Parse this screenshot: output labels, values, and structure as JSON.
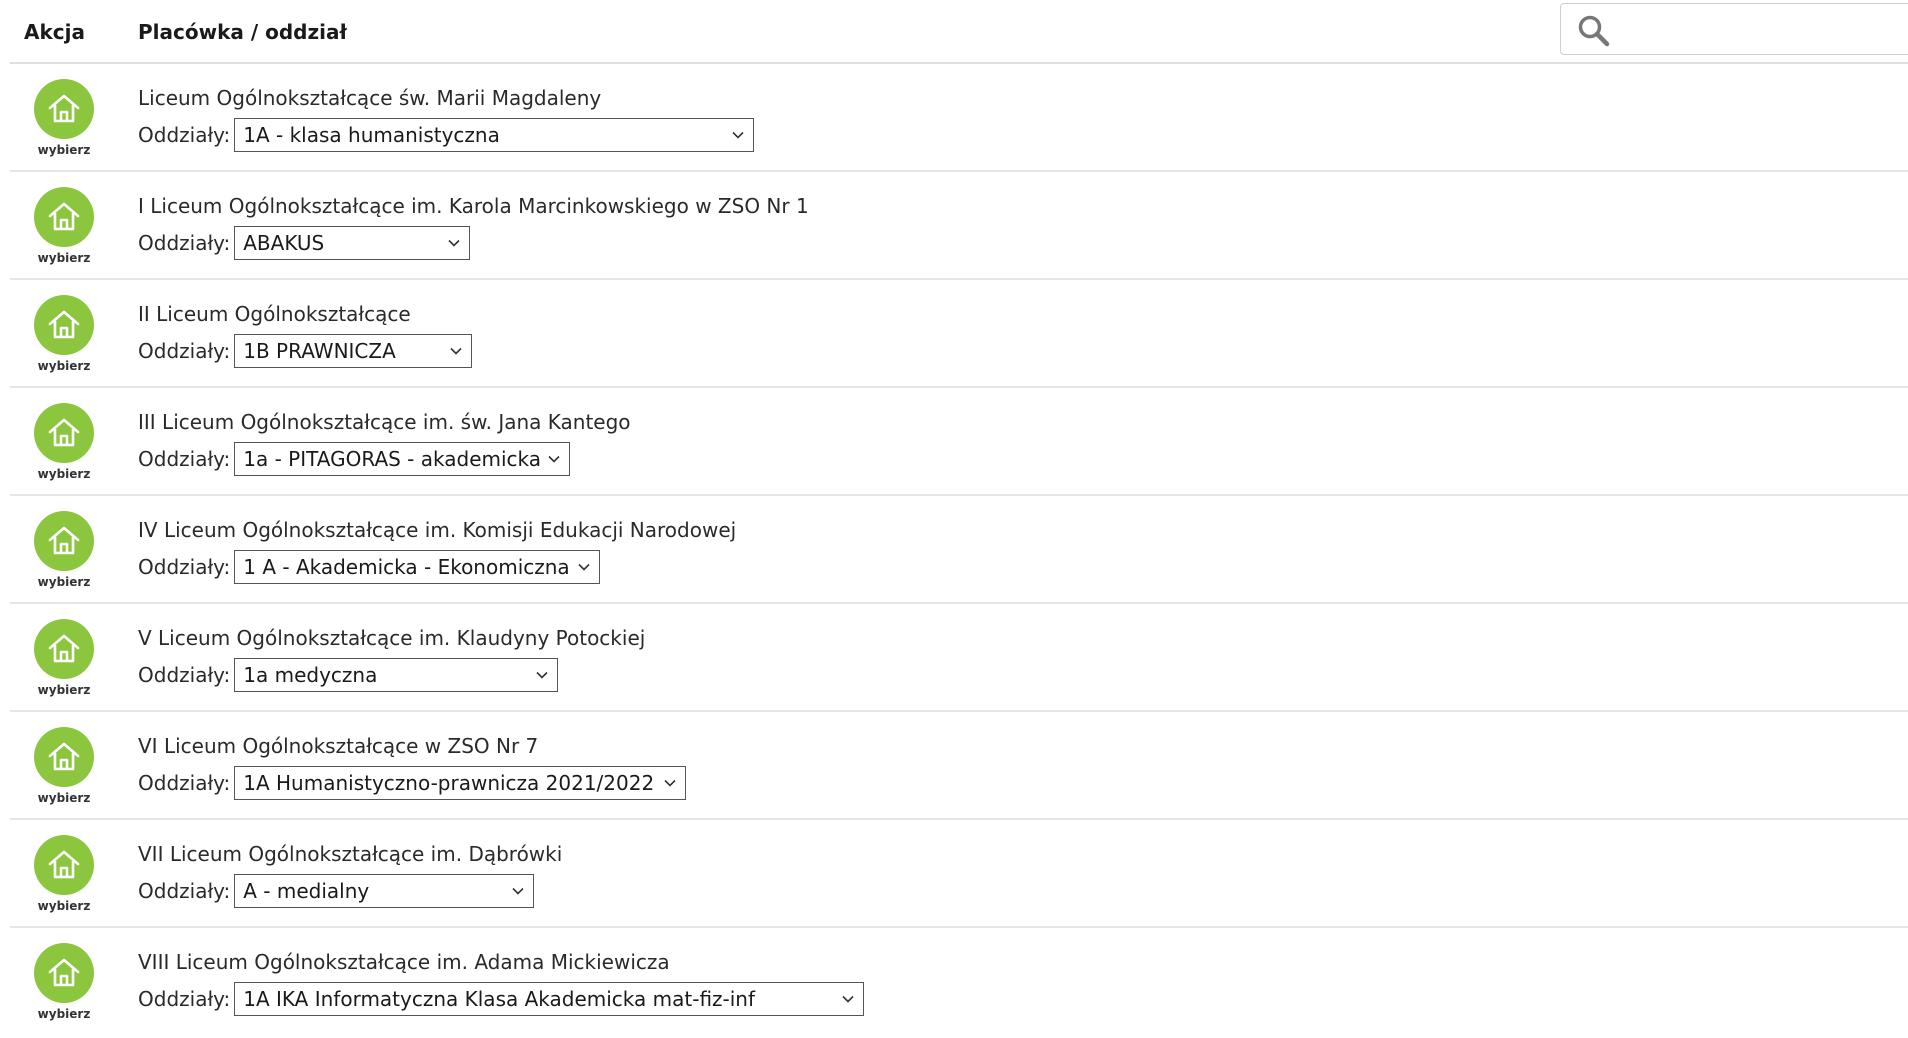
{
  "header": {
    "action_label": "Akcja",
    "school_label": "Placówka / oddział",
    "search_placeholder": "",
    "search_value": ""
  },
  "colors": {
    "accent": "#8cc63f",
    "divider": "#e6e6e6"
  },
  "dept_prefix": "Oddziały:",
  "action_button_label": "wybierz",
  "icons": {
    "action": "home-icon",
    "search": "search-icon",
    "dropdown": "chevron-down-icon"
  },
  "schools": [
    {
      "name": "Liceum Ogólnokształcące św. Marii Magdaleny",
      "selected_department": "1A - klasa humanistyczna"
    },
    {
      "name": "I Liceum Ogólnokształcące im. Karola Marcinkowskiego w ZSO Nr 1",
      "selected_department": "ABAKUS"
    },
    {
      "name": "II Liceum Ogólnokształcące",
      "selected_department": "1B PRAWNICZA"
    },
    {
      "name": "III Liceum Ogólnokształcące im. św. Jana Kantego",
      "selected_department": "1a - PITAGORAS - akademicka"
    },
    {
      "name": "IV Liceum Ogólnokształcące im. Komisji Edukacji Narodowej",
      "selected_department": "1 A - Akademicka - Ekonomiczna"
    },
    {
      "name": "V Liceum Ogólnokształcące im. Klaudyny Potockiej",
      "selected_department": "1a medyczna"
    },
    {
      "name": "VI Liceum Ogólnokształcące w ZSO Nr 7",
      "selected_department": "1A Humanistyczno-prawnicza 2021/2022"
    },
    {
      "name": "VII Liceum Ogólnokształcące im. Dąbrówki",
      "selected_department": "A - medialny"
    },
    {
      "name": "VIII Liceum Ogólnokształcące im. Adama Mickiewicza",
      "selected_department": "1A IKA Informatyczna Klasa Akademicka mat-fiz-inf"
    }
  ]
}
